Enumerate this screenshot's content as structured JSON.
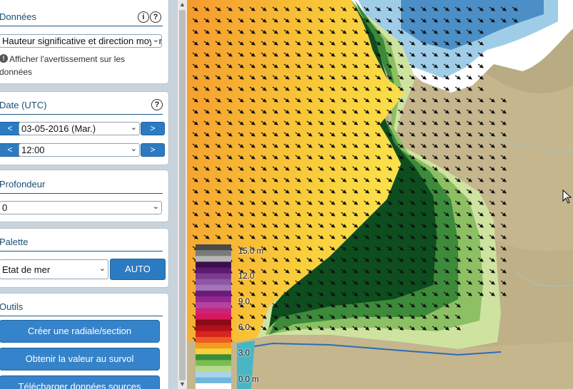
{
  "sidebar": {
    "donnees": {
      "title": "Données",
      "info_icon": "info-icon",
      "help_icon": "help-icon",
      "dataset_value": "Hauteur significative et direction moyenne",
      "warning_text_line1": "Afficher l'avertissement sur les",
      "warning_text_line2": "données"
    },
    "date": {
      "title": "Date (UTC)",
      "prev_label": "<",
      "next_label": ">",
      "date_value": "03-05-2016 (Mar.)",
      "time_value": "12:00"
    },
    "profondeur": {
      "title": "Profondeur",
      "value": "0"
    },
    "palette": {
      "title": "Palette",
      "value": "Etat de mer",
      "auto_label": "AUTO"
    },
    "outils": {
      "title": "Outils",
      "buttons": [
        "Créer une radiale/section",
        "Obtenir la valeur au survol",
        "Télécharger données sources"
      ]
    }
  },
  "legend": {
    "labels": [
      "15.0 m",
      "12.0",
      "9.0",
      "6.0",
      "3.0",
      "0.0 m"
    ],
    "colors": [
      "#4a4a4a",
      "#7a7a7a",
      "#b5b5b5",
      "#3b0f4c",
      "#5c1a72",
      "#7b3a8f",
      "#8f57a3",
      "#a374b6",
      "#6a1b78",
      "#93278f",
      "#b4439f",
      "#c8257e",
      "#d7195b",
      "#8b0a14",
      "#b2101c",
      "#d7261d",
      "#ee5a24",
      "#f39c1f",
      "#f7d23a",
      "#3a8d3a",
      "#7cbc55",
      "#b7d98a",
      "#a8d4ea",
      "#6fb6dc",
      "#ffffff"
    ]
  },
  "map": {
    "arrow_direction": "south-east"
  }
}
